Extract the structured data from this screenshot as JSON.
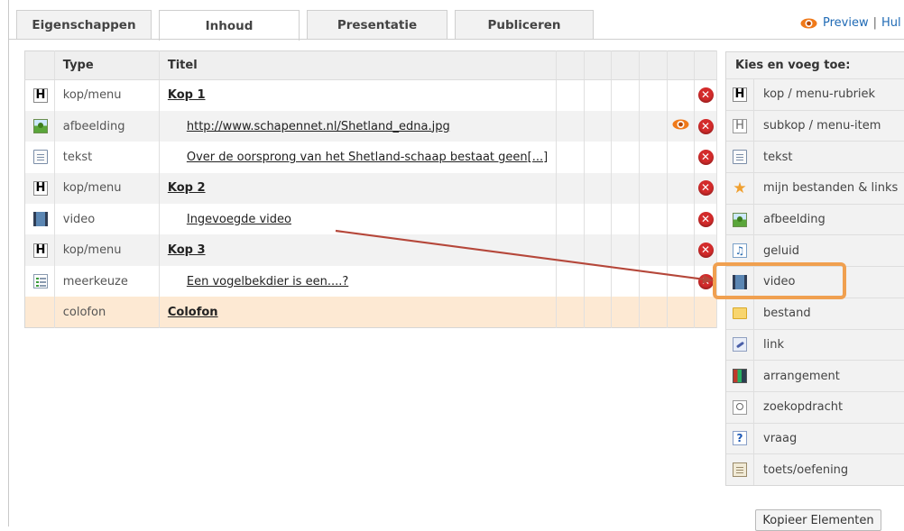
{
  "tabs": [
    {
      "label": "Eigenschappen",
      "active": false
    },
    {
      "label": "Inhoud",
      "active": true
    },
    {
      "label": "Presentatie",
      "active": false
    },
    {
      "label": "Publiceren",
      "active": false
    }
  ],
  "top_right": {
    "preview_label": "Preview",
    "separator": "|",
    "help_label": "Hul"
  },
  "table": {
    "headers": {
      "type": "Type",
      "title": "Titel"
    },
    "rows": [
      {
        "icon": "heading-icon",
        "type": "kop/menu",
        "title": "Kop 1",
        "style": "head",
        "view": false,
        "delete": true
      },
      {
        "icon": "image-icon",
        "type": "afbeelding",
        "title": "http://www.schapennet.nl/Shetland_edna.jpg",
        "style": "sub",
        "view": true,
        "delete": true
      },
      {
        "icon": "text-icon",
        "type": "tekst",
        "title": "Over de oorsprong van het Shetland-schaap bestaat geen[...]",
        "style": "sub",
        "view": false,
        "delete": true
      },
      {
        "icon": "heading-icon",
        "type": "kop/menu",
        "title": "Kop 2",
        "style": "head",
        "view": false,
        "delete": true
      },
      {
        "icon": "video-icon",
        "type": "video",
        "title": "Ingevoegde video",
        "style": "sub",
        "view": false,
        "delete": true
      },
      {
        "icon": "heading-icon",
        "type": "kop/menu",
        "title": "Kop 3",
        "style": "head",
        "view": false,
        "delete": true
      },
      {
        "icon": "list-icon",
        "type": "meerkeuze",
        "title": "Een vogelbekdier is een....?",
        "style": "sub",
        "view": false,
        "delete": true
      },
      {
        "icon": "",
        "type": "colofon",
        "title": "Colofon",
        "style": "head",
        "view": false,
        "delete": false
      }
    ]
  },
  "side_panel": {
    "title": "Kies en voeg toe:",
    "items": [
      {
        "icon": "heading-icon",
        "label": "kop / menu-rubriek"
      },
      {
        "icon": "subheading-icon",
        "label": "subkop / menu-item"
      },
      {
        "icon": "text-icon",
        "label": "tekst"
      },
      {
        "icon": "star-icon",
        "label": "mijn bestanden & links"
      },
      {
        "icon": "image-icon",
        "label": "afbeelding"
      },
      {
        "icon": "music-note-icon",
        "label": "geluid"
      },
      {
        "icon": "video-icon",
        "label": "video"
      },
      {
        "icon": "folder-icon",
        "label": "bestand"
      },
      {
        "icon": "link-icon",
        "label": "link"
      },
      {
        "icon": "arrangement-icon",
        "label": "arrangement"
      },
      {
        "icon": "search-icon",
        "label": "zoekopdracht"
      },
      {
        "icon": "question-icon",
        "label": "vraag"
      },
      {
        "icon": "clipboard-icon",
        "label": "toets/oefening"
      }
    ]
  },
  "copy_button": "Kopieer Elementen",
  "highlight_color": "#f0a050",
  "arrow_color": "#b5473a"
}
